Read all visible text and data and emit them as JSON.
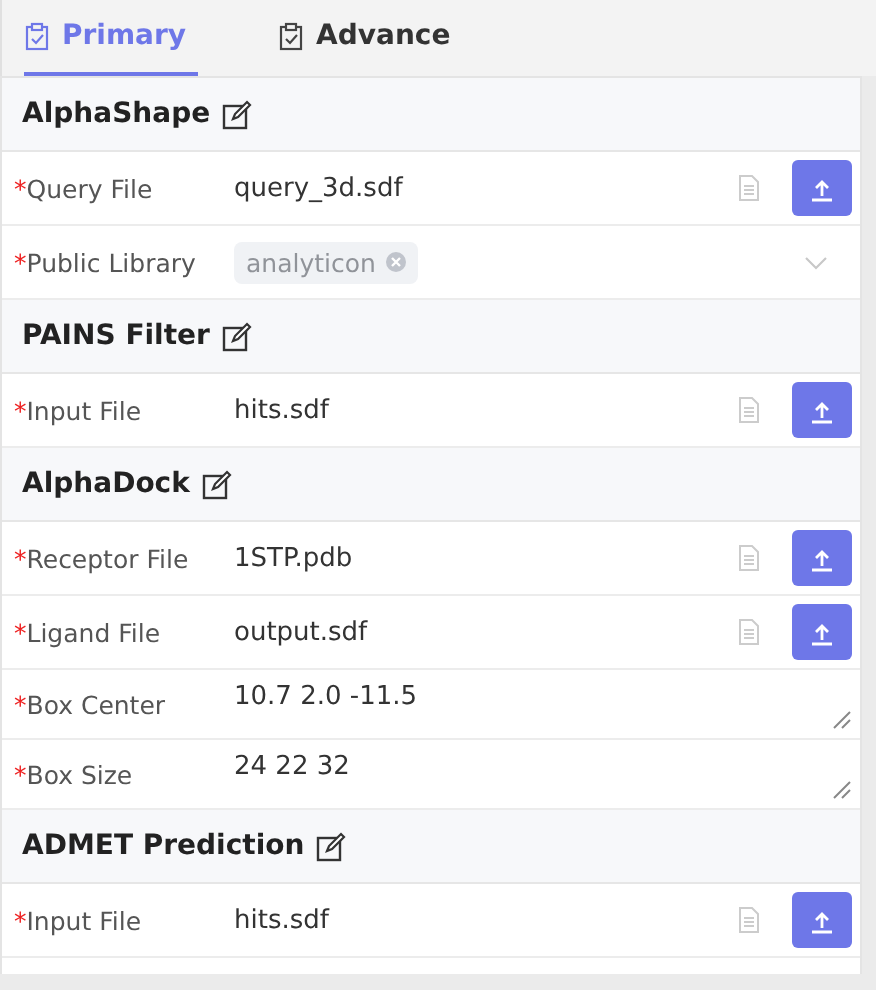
{
  "tabs": [
    {
      "label": "Primary",
      "selected": true
    },
    {
      "label": "Advance",
      "selected": false
    }
  ],
  "sections": [
    {
      "title": "AlphaShape",
      "fields": [
        {
          "kind": "file",
          "mark": "*",
          "label": "Query File",
          "value": "query_3d.sdf"
        },
        {
          "kind": "tags",
          "mark": "*",
          "label": "Public Library",
          "tags": [
            "analyticon"
          ]
        }
      ]
    },
    {
      "title": "PAINS Filter",
      "fields": [
        {
          "kind": "file",
          "mark": "*",
          "label": "Input File",
          "value": "hits.sdf"
        }
      ]
    },
    {
      "title": "AlphaDock",
      "fields": [
        {
          "kind": "file",
          "mark": "*",
          "label": "Receptor File",
          "value": "1STP.pdb"
        },
        {
          "kind": "file",
          "mark": "*",
          "label": "Ligand File",
          "value": "output.sdf"
        },
        {
          "kind": "textarea",
          "mark": "*",
          "label": "Box Center",
          "value": "10.7 2.0 -11.5"
        },
        {
          "kind": "textarea",
          "mark": "*",
          "label": "Box Size",
          "value": "24 22 32"
        }
      ]
    },
    {
      "title": "ADMET Prediction",
      "fields": [
        {
          "kind": "file",
          "mark": "*",
          "label": "Input File",
          "value": "hits.sdf"
        }
      ]
    }
  ]
}
